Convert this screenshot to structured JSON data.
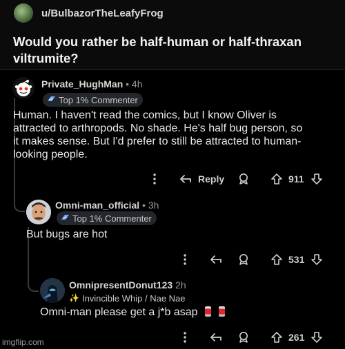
{
  "post": {
    "username": "u/BulbazorTheLeafyFrog",
    "title": "Would you rather be half-human or half-thraxan viltrumite?"
  },
  "comments": [
    {
      "username": "Private_HughMan",
      "time": "• 4h",
      "flair": "Top 1% Commenter",
      "body": "Human. I haven't read the comics, but I know Oliver is attracted to arthropods. No shade. He's half bug person, so it makes sense. But I'd prefer to still be attracted to human-looking people.",
      "reply_label": "Reply",
      "score": "911"
    },
    {
      "username": "Omni-man_official",
      "time": "• 3h",
      "flair": "Top 1% Commenter",
      "body": "But bugs are hot",
      "score": "531"
    },
    {
      "username": "OmnipresentDonut123",
      "time": "2h",
      "flair": "Invincible Whip / Nae Nae",
      "body": "Omni-man please get a j*b asap",
      "score": "261"
    }
  ],
  "watermark": "imgflip.com",
  "colors": {
    "background": "#000000",
    "header": "#0b0b0b",
    "flair_bg": "#23272c",
    "thread_line": "#3a3a3a"
  },
  "icons": [
    "more-icon",
    "reply-arrow-icon",
    "award-icon",
    "upvote-icon",
    "downvote-icon",
    "top-commenter-icon",
    "sparkles-icon",
    "soda-can-icon"
  ]
}
